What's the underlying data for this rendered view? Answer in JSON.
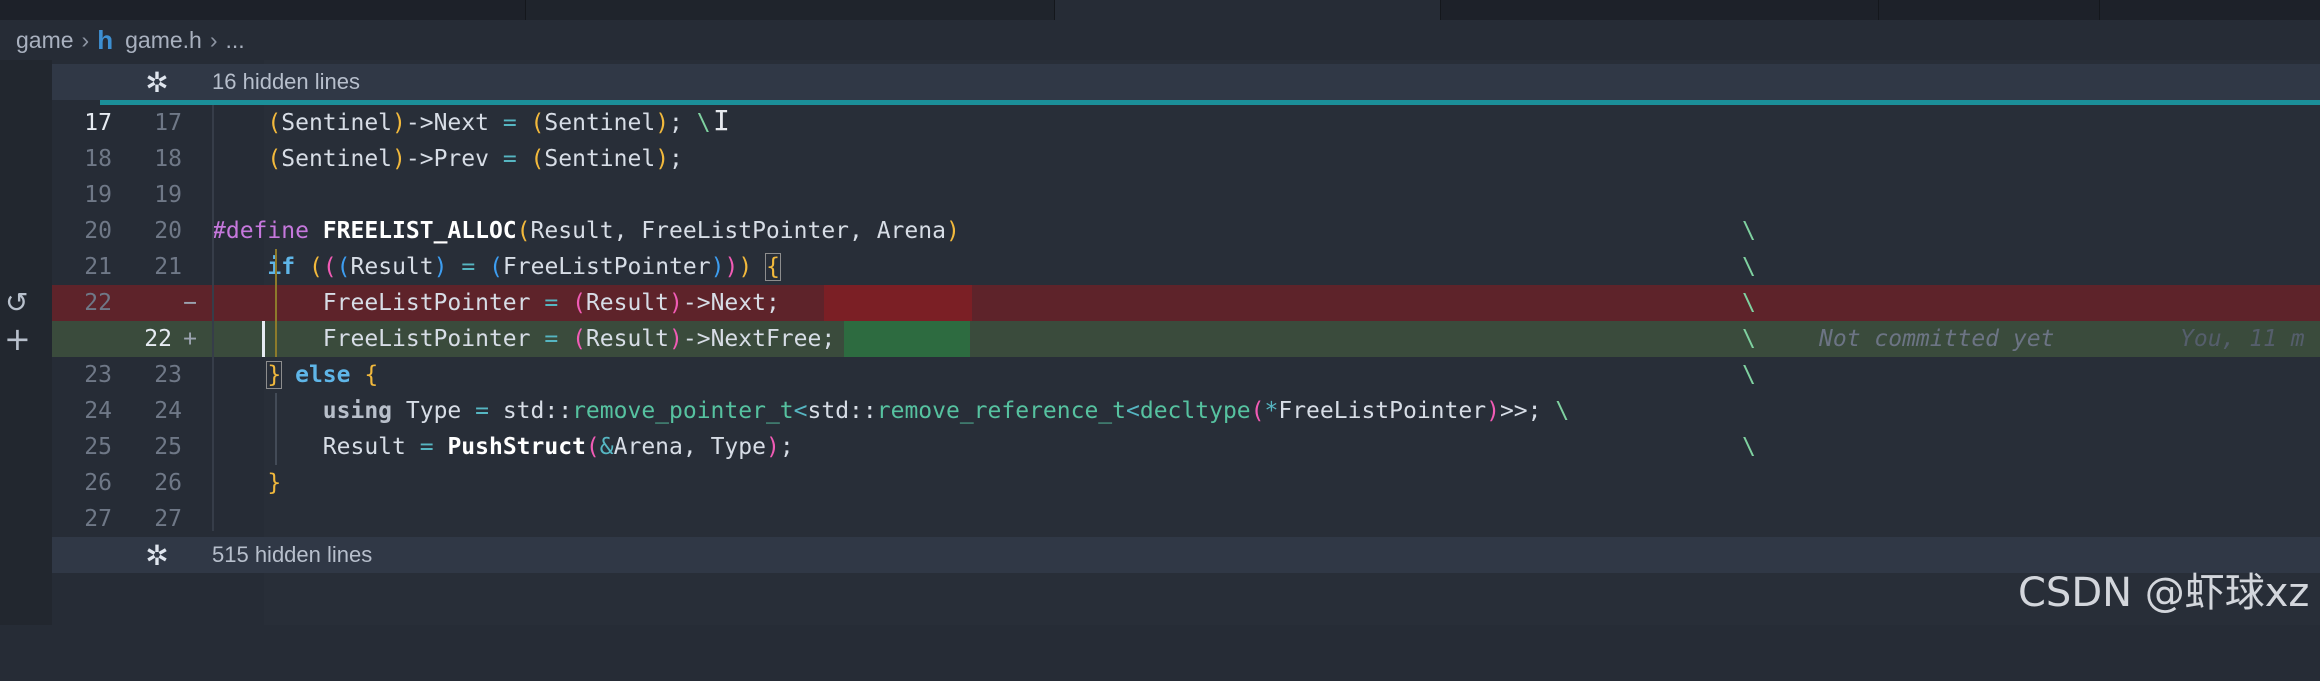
{
  "breadcrumb": {
    "folder": "game",
    "file": "game.h",
    "ellipsis": "..."
  },
  "folding": {
    "top_label": "16 hidden lines",
    "bottom_label": "515 hidden lines"
  },
  "rows": [
    {
      "old": "17",
      "new": "17",
      "code": "    (Sentinel)->Next = (Sentinel); \\"
    },
    {
      "old": "18",
      "new": "18",
      "code": "    (Sentinel)->Prev = (Sentinel);"
    },
    {
      "old": "19",
      "new": "19",
      "code": ""
    },
    {
      "old": "20",
      "new": "20",
      "code": "#define FREELIST_ALLOC(Result, FreeListPointer, Arena)"
    },
    {
      "old": "21",
      "new": "21",
      "code": "    if (((Result) = (FreeListPointer))) {"
    },
    {
      "old": "22",
      "new": "",
      "code": "        FreeListPointer = (Result)->Next;",
      "mark": "−"
    },
    {
      "old": "",
      "new": "22",
      "code": "        FreeListPointer = (Result)->NextFree;",
      "mark": "+"
    },
    {
      "old": "23",
      "new": "23",
      "code": "    } else {"
    },
    {
      "old": "24",
      "new": "24",
      "code": "        using Type = std::remove_pointer_t<std::remove_reference_t<decltype(*FreeListPointer)>>; \\"
    },
    {
      "old": "25",
      "new": "25",
      "code": "        Result = PushStruct(&Arena, Type);"
    },
    {
      "old": "26",
      "new": "26",
      "code": "    }"
    },
    {
      "old": "27",
      "new": "27",
      "code": ""
    }
  ],
  "line_continuation": "\\",
  "blame": {
    "text": "Not committed yet",
    "author": "You, 11 m"
  },
  "watermark": "CSDN @虾球xz",
  "icons": {
    "unfold": "unfold-icon",
    "revert": "revert-icon",
    "stage": "plus-icon",
    "file_type": "h-file-icon"
  },
  "colors": {
    "deleted_bg": "#5e232a",
    "added_bg": "#3a4b3c",
    "hunk_accent": "#1b8f99"
  }
}
